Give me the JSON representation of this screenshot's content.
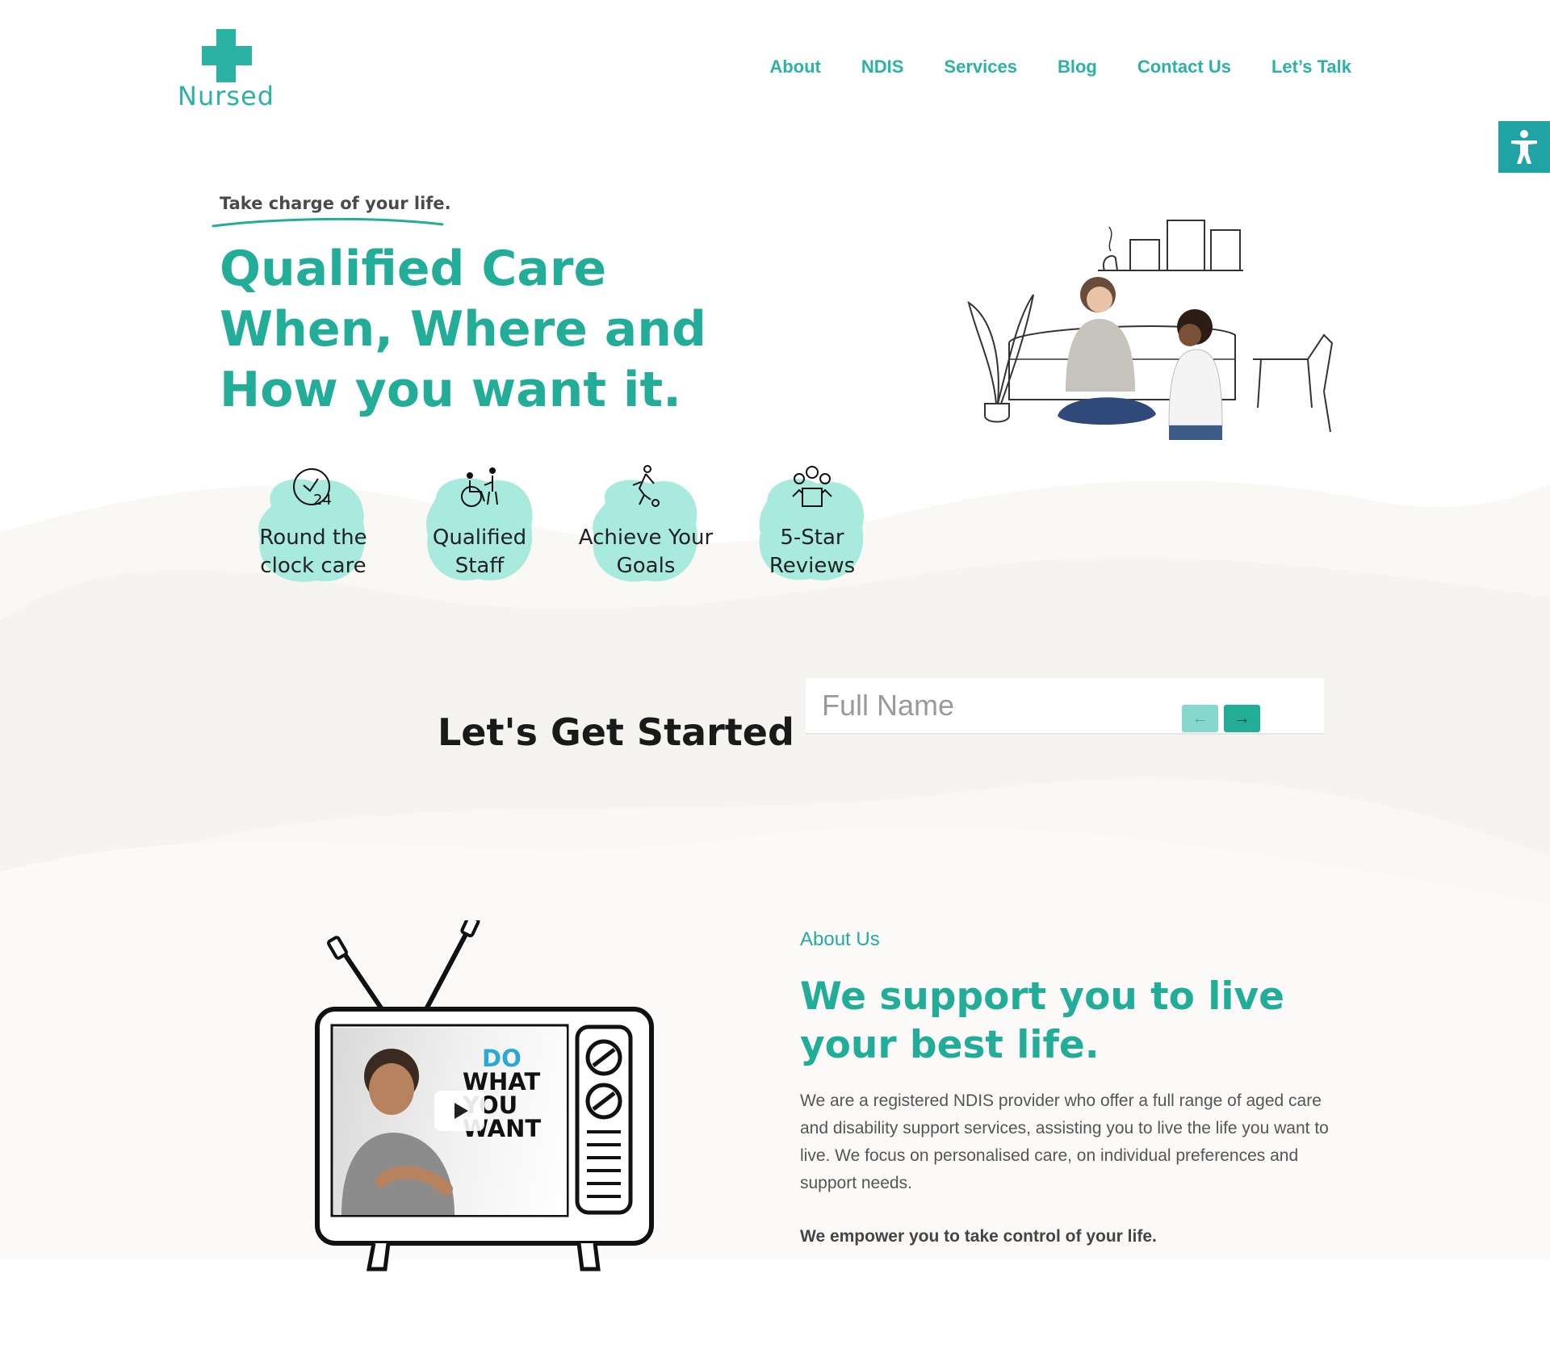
{
  "brand": {
    "name": "Nursed",
    "accent": "#22ad99",
    "dark_accent": "#1fa3a5"
  },
  "nav": {
    "items": [
      {
        "label": "About"
      },
      {
        "label": "NDIS"
      },
      {
        "label": "Services"
      },
      {
        "label": "Blog"
      },
      {
        "label": "Contact Us"
      },
      {
        "label": "Let’s Talk"
      }
    ]
  },
  "accessibility": {
    "icon": "accessibility-icon"
  },
  "hero": {
    "tagline": "Take charge of your life.",
    "title": "Qualified Care When, Where and How you want it.",
    "illustration": "woman-and-child-illustration"
  },
  "features": [
    {
      "icon": "clock-24-icon",
      "label": "Round the clock care"
    },
    {
      "icon": "wheelchair-carer-icon",
      "label": "Qualified Staff"
    },
    {
      "icon": "runner-goal-icon",
      "label": "Achieve Your Goals"
    },
    {
      "icon": "reviews-people-icon",
      "label": "5-Star Reviews"
    }
  ],
  "get_started": {
    "title": "Let's Get Started",
    "name_placeholder": "Full Name",
    "prev": "←",
    "next": "→"
  },
  "about": {
    "kicker": "About Us",
    "title": "We support you to live your best life.",
    "body": "We are a registered NDIS provider who offer a full range of aged care and disability support services, assisting you to live the life you want to live. We focus on personalised care,  on individual preferences and support needs.",
    "strong": "We empower you to take control of your life.",
    "video": {
      "words": [
        "DO",
        "WHAT",
        "YOU",
        "WANT"
      ]
    }
  }
}
